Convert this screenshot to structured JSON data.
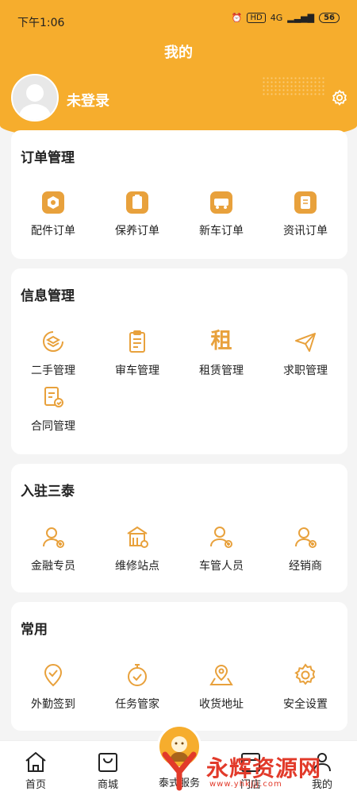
{
  "status_bar": {
    "time": "下午1:06",
    "network": "4G",
    "hd": "HD",
    "battery": "56"
  },
  "header": {
    "title": "我的",
    "login_text": "未登录"
  },
  "sections": {
    "order": {
      "title": "订单管理",
      "items": [
        "配件订单",
        "保养订单",
        "新车订单",
        "资讯订单"
      ]
    },
    "info": {
      "title": "信息管理",
      "items": [
        "二手管理",
        "审车管理",
        "租赁管理",
        "求职管理",
        "合同管理"
      ],
      "rent_glyph": "租"
    },
    "join": {
      "title": "入驻三泰",
      "items": [
        "金融专员",
        "维修站点",
        "车管人员",
        "经销商"
      ]
    },
    "common": {
      "title": "常用",
      "items": [
        "外勤签到",
        "任务管家",
        "收货地址",
        "安全设置"
      ]
    }
  },
  "bottom_nav": {
    "items": [
      "首页",
      "商城",
      "泰式服务",
      "门店",
      "我的"
    ]
  },
  "watermark": {
    "text": "永辉资源网",
    "url": "www.yhkjjj.com"
  },
  "colors": {
    "accent": "#f6ad2d",
    "icon": "#e8a13c",
    "watermark": "#e23a2a"
  }
}
